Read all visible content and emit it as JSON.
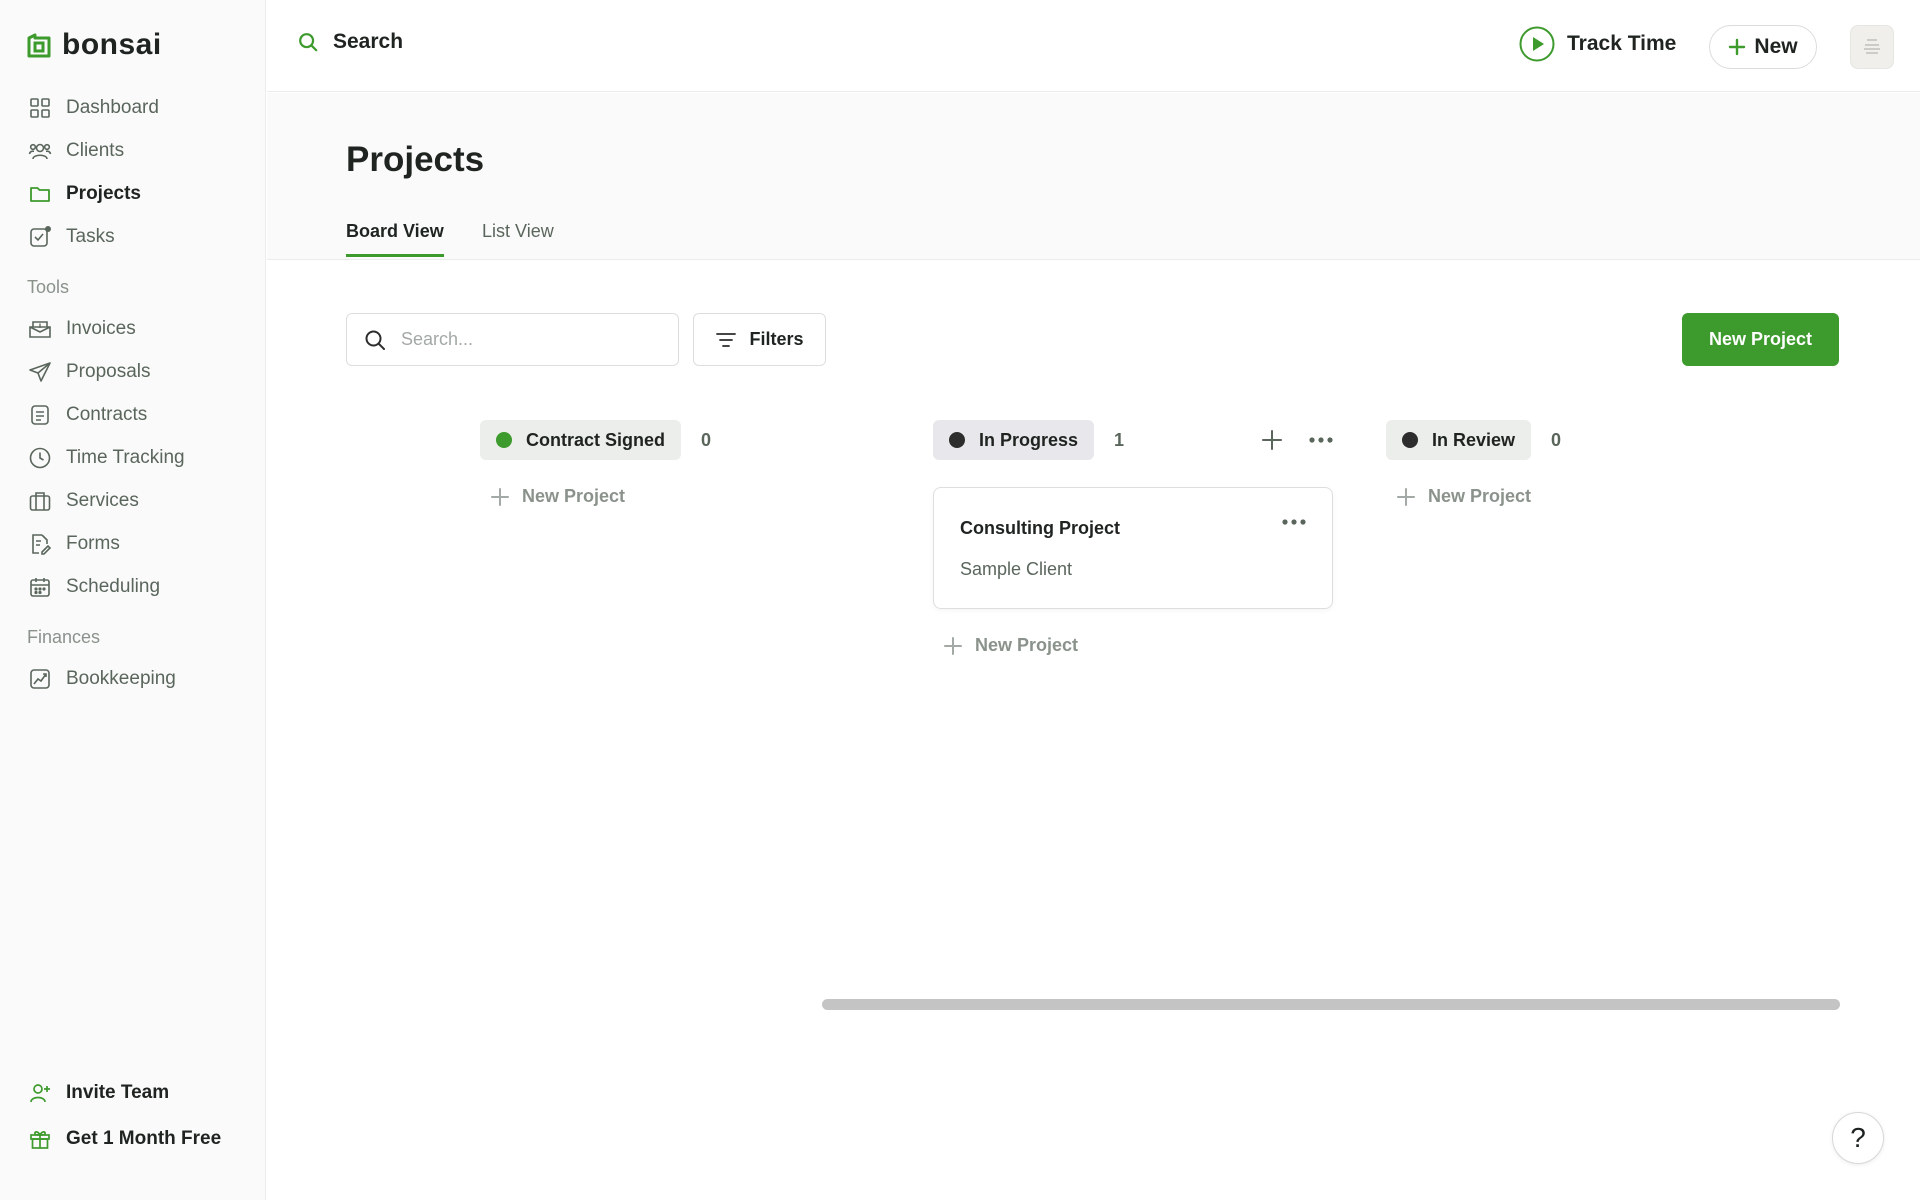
{
  "brand": {
    "name": "bonsai",
    "accent": "#3d9a2c"
  },
  "sidebar": {
    "main_items": [
      {
        "label": "Dashboard",
        "icon": "dashboard-icon"
      },
      {
        "label": "Clients",
        "icon": "clients-icon"
      },
      {
        "label": "Projects",
        "icon": "folder-icon",
        "active": true
      },
      {
        "label": "Tasks",
        "icon": "tasks-icon"
      }
    ],
    "tools_label": "Tools",
    "tools_items": [
      {
        "label": "Invoices",
        "icon": "invoice-icon"
      },
      {
        "label": "Proposals",
        "icon": "send-icon"
      },
      {
        "label": "Contracts",
        "icon": "contract-icon"
      },
      {
        "label": "Time Tracking",
        "icon": "clock-icon"
      },
      {
        "label": "Services",
        "icon": "briefcase-icon"
      },
      {
        "label": "Forms",
        "icon": "form-icon"
      },
      {
        "label": "Scheduling",
        "icon": "calendar-icon"
      }
    ],
    "finances_label": "Finances",
    "finances_items": [
      {
        "label": "Bookkeeping",
        "icon": "chart-icon"
      }
    ],
    "bottom_items": [
      {
        "label": "Invite Team",
        "icon": "add-user-icon"
      },
      {
        "label": "Get 1 Month Free",
        "icon": "gift-icon"
      }
    ]
  },
  "topbar": {
    "search_label": "Search",
    "track_time_label": "Track Time",
    "new_label": "New"
  },
  "page": {
    "title": "Projects",
    "tabs": [
      {
        "label": "Board View",
        "active": true
      },
      {
        "label": "List View",
        "active": false
      }
    ],
    "search_placeholder": "Search...",
    "filters_label": "Filters",
    "new_project_label": "New Project"
  },
  "board": {
    "columns": [
      {
        "name": "Contract Signed",
        "count": "0",
        "dot_color": "#3d9a2c",
        "pill_bg": "#eceeeb",
        "add_label": "New Project",
        "cards": []
      },
      {
        "name": "In Progress",
        "count": "1",
        "dot_color": "#2d2d2d",
        "pill_bg": "#e8e8ec",
        "add_label": "New Project",
        "cards": [
          {
            "title": "Consulting Project",
            "client": "Sample Client"
          }
        ]
      },
      {
        "name": "In Review",
        "count": "0",
        "dot_color": "#2d2d2d",
        "pill_bg": "#eceeeb",
        "add_label": "New Project",
        "cards": []
      }
    ]
  },
  "help": {
    "label": "?"
  }
}
